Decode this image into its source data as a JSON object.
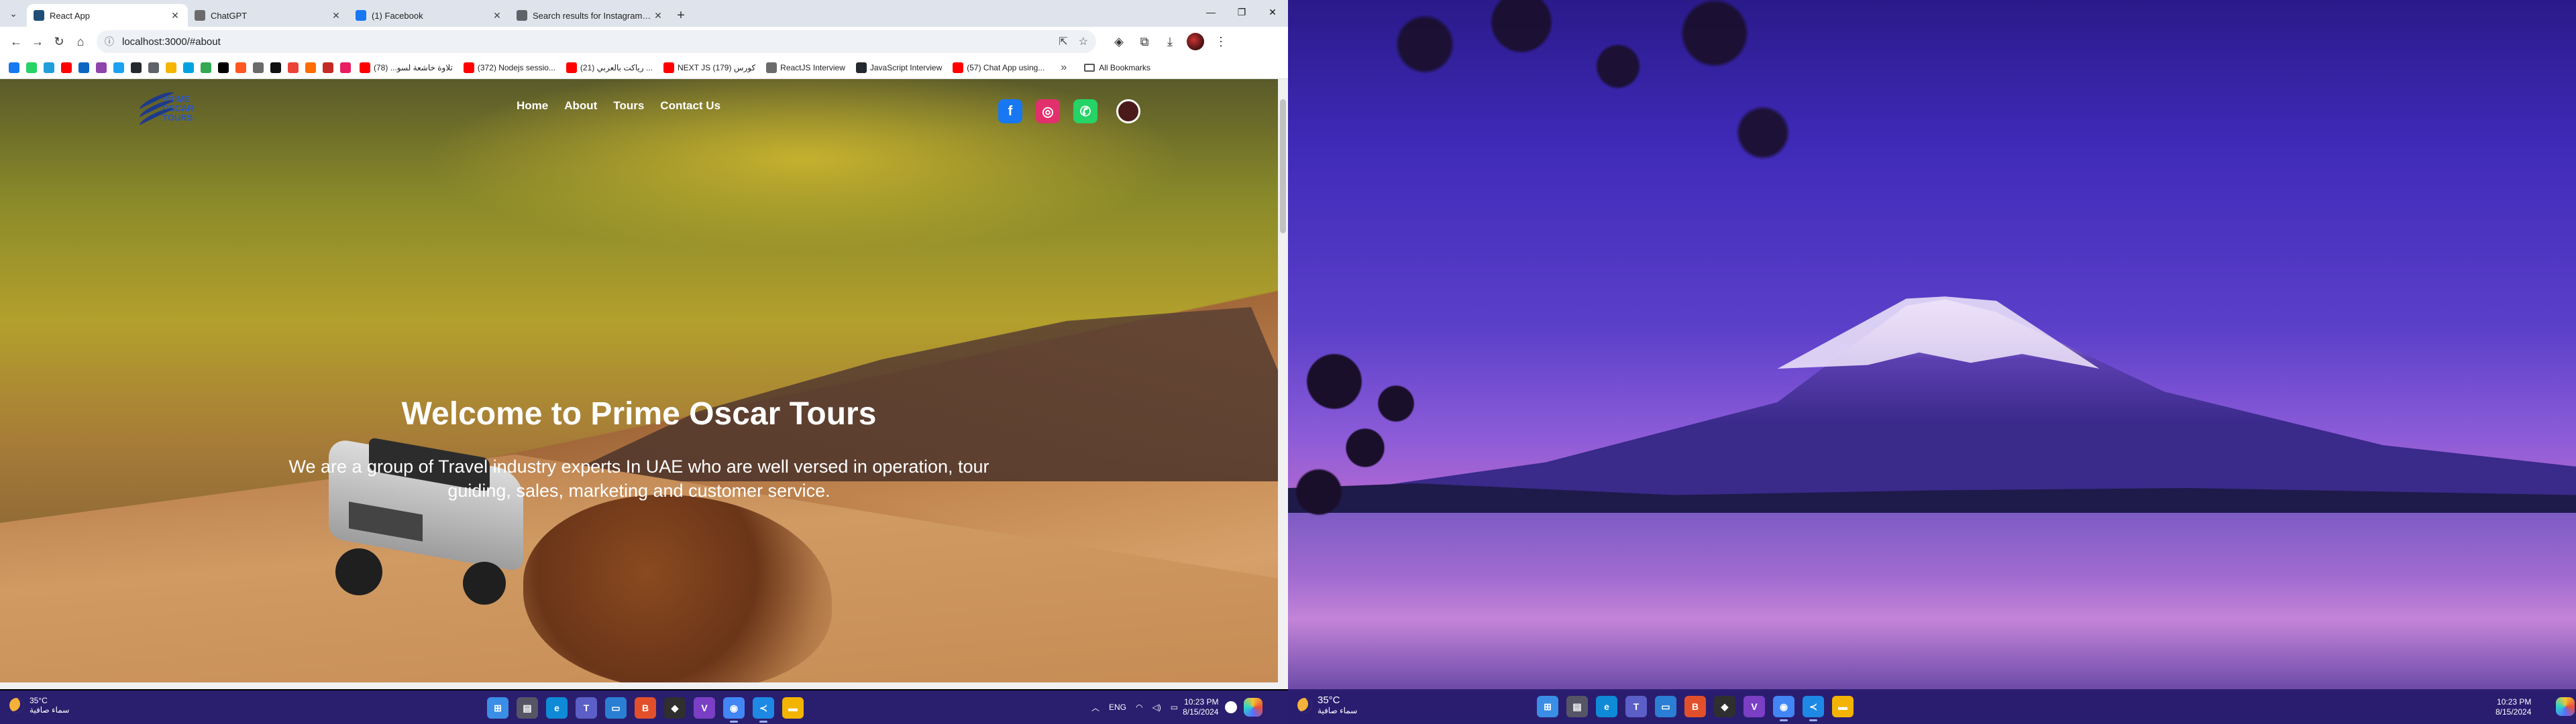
{
  "browser": {
    "tabs": [
      {
        "label": "React App",
        "active": true,
        "favicon_color": "#1f4e79"
      },
      {
        "label": "ChatGPT",
        "active": false,
        "favicon_color": "#6b6b6b"
      },
      {
        "label": "(1) Facebook",
        "active": false,
        "favicon_color": "#1877f2"
      },
      {
        "label": "Search results for Instagram - I",
        "active": false,
        "favicon_color": "#5f6368"
      }
    ],
    "new_tab": "+",
    "url": "localhost:3000/#about",
    "bookmarks": [
      {
        "label": "تلاوة خاشعة لسو... (78)",
        "icon_color": "#ff0000"
      },
      {
        "label": "(372) Nodejs sessio...",
        "icon_color": "#ff0000"
      },
      {
        "label": "(21) رياكت بالعربي ...",
        "icon_color": "#ff0000"
      },
      {
        "label": "NEXT JS كورس (179)",
        "icon_color": "#ff0000"
      },
      {
        "label": "ReactJS Interview",
        "icon_color": "#6b6b6b"
      },
      {
        "label": "JavaScript Interview",
        "icon_color": "#24292f"
      },
      {
        "label": "(57) Chat App using...",
        "icon_color": "#ff0000"
      }
    ],
    "bookmark_icon_colors": [
      "#1877f2",
      "#25d366",
      "#229ed9",
      "#ff0000",
      "#0a66c2",
      "#8e44ad",
      "#1da1f2",
      "#24292f",
      "#5f6368",
      "#f4b400",
      "#00a3e0",
      "#34a853",
      "#000000",
      "#ff5722",
      "#6b6b6b",
      "#111111",
      "#ea4335",
      "#ff6d00",
      "#c62828",
      "#e91e63"
    ],
    "all_bookmarks": "All Bookmarks"
  },
  "site": {
    "logo": {
      "line1": "PRIME",
      "line2": "OSCAR",
      "line3": "TOURS"
    },
    "nav": [
      "Home",
      "About",
      "Tours",
      "Contact Us"
    ],
    "socials": [
      {
        "name": "facebook",
        "glyph": "f",
        "color": "#1877f2"
      },
      {
        "name": "instagram",
        "glyph": "◎",
        "color": "#e1306c"
      },
      {
        "name": "whatsapp",
        "glyph": "✆",
        "color": "#25d366"
      },
      {
        "name": "profile",
        "glyph": "",
        "color": "#4a1a1a"
      }
    ],
    "hero_title": "Welcome to Prime Oscar Tours",
    "hero_subtitle": "We are a group of Travel industry experts In UAE who are well versed in operation, tour guiding, sales, marketing and customer service."
  },
  "taskbar_left": {
    "weather": {
      "temp": "35°C",
      "desc": "سماء صافية"
    },
    "apps": [
      {
        "name": "start",
        "color": "#3a8ee6",
        "glyph": "⊞"
      },
      {
        "name": "file-explorer",
        "color": "#556",
        "glyph": "▤"
      },
      {
        "name": "edge",
        "color": "#0f8ad6",
        "glyph": "e"
      },
      {
        "name": "teams",
        "color": "#5b5fc7",
        "glyph": "T"
      },
      {
        "name": "remote",
        "color": "#2a7fd4",
        "glyph": "▭"
      },
      {
        "name": "brave",
        "color": "#e2502b",
        "glyph": "B"
      },
      {
        "name": "node",
        "color": "#2f2f2f",
        "glyph": "◆"
      },
      {
        "name": "visual-studio",
        "color": "#7a3fc4",
        "glyph": "V"
      },
      {
        "name": "chrome",
        "color": "#4285f4",
        "glyph": "◉"
      },
      {
        "name": "vscode",
        "color": "#1e88e5",
        "glyph": "≺"
      },
      {
        "name": "folder",
        "color": "#f2b400",
        "glyph": "▬"
      }
    ],
    "tray": {
      "lang": "ENG",
      "time": "10:23 PM",
      "date": "8/15/2024"
    }
  },
  "taskbar_right": {
    "weather": {
      "temp": "35°C",
      "desc": "سماء صافية"
    },
    "clock": {
      "time": "10:23 PM",
      "date": "8/15/2024"
    }
  }
}
